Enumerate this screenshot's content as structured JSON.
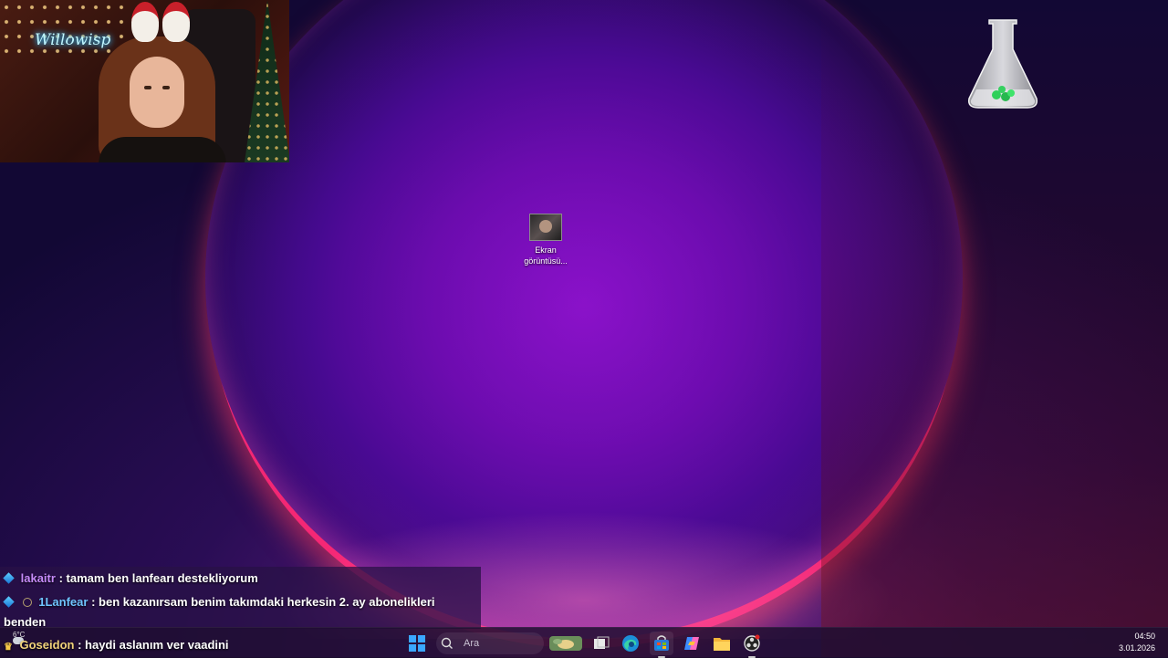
{
  "webcam": {
    "neon_text": "Willowisp"
  },
  "desktop": {
    "icons": [
      {
        "label_line1": "Ekran",
        "label_line2": "görüntüsü..."
      }
    ]
  },
  "chat": {
    "messages": [
      {
        "user": "lakaitr",
        "user_color": "#c58af9",
        "text": "tamam ben lanfearı destekliyorum"
      },
      {
        "user": "1Lanfear",
        "user_color": "#6fc4ff",
        "text": "ben kazanırsam benim takımdaki herkesin 2. ay abonelikleri",
        "text_cont": "benden"
      },
      {
        "user": "Goseidon",
        "user_color": "#f0d27a",
        "text": "haydi aslanım ver vaadini"
      }
    ]
  },
  "taskbar": {
    "weather_temp": "6°C",
    "search_placeholder": "Ara",
    "clock_time": "04:50",
    "clock_date": "3.01.2026",
    "apps": [
      "start-icon",
      "search-icon",
      "widgets-icon",
      "task-view-icon",
      "edge-icon",
      "store-icon",
      "copilot-icon",
      "file-explorer-icon",
      "obs-icon"
    ]
  }
}
